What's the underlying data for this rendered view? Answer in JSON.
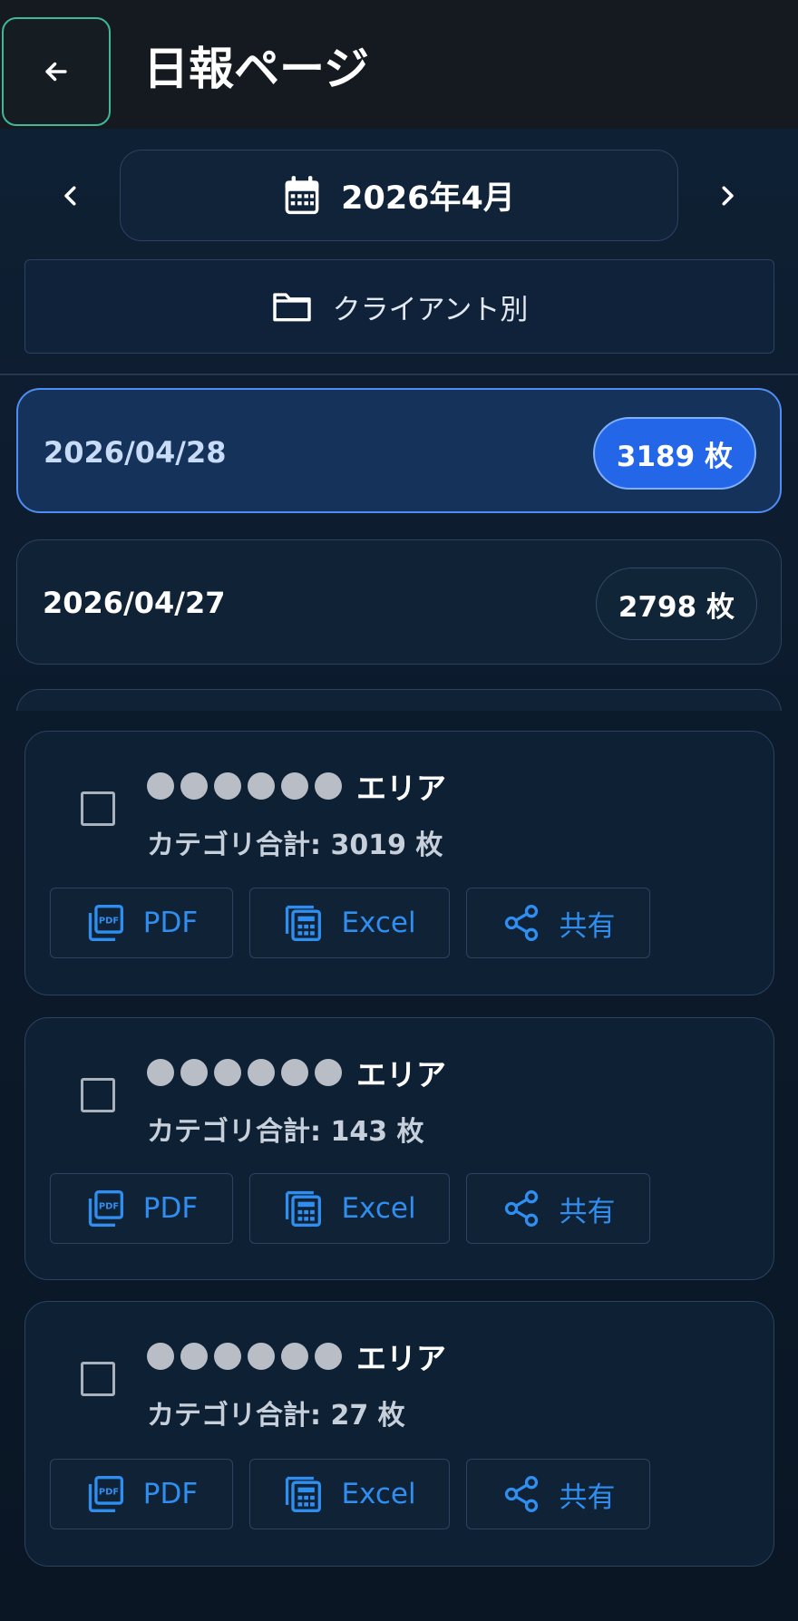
{
  "header": {
    "title": "日報ページ"
  },
  "month_nav": {
    "label": "2026年4月"
  },
  "filter": {
    "label": "クライアント別"
  },
  "dates": [
    {
      "date": "2026/04/28",
      "count": "3189 枚",
      "selected": true
    },
    {
      "date": "2026/04/27",
      "count": "2798 枚",
      "selected": false
    }
  ],
  "areas": [
    {
      "name": "エリア",
      "total": "カテゴリ合計: 3019 枚",
      "pdf": "PDF",
      "excel": "Excel",
      "share": "共有"
    },
    {
      "name": "エリア",
      "total": "カテゴリ合計: 143 枚",
      "pdf": "PDF",
      "excel": "Excel",
      "share": "共有"
    },
    {
      "name": "エリア",
      "total": "カテゴリ合計: 27 枚",
      "pdf": "PDF",
      "excel": "Excel",
      "share": "共有"
    }
  ],
  "colors": {
    "accent": "#2f8ef0",
    "selected_pill": "#2466e8",
    "back_border": "#3fb89a"
  },
  "icons": [
    "arrow-left-icon",
    "chevron-left-icon",
    "chevron-right-icon",
    "calendar-icon",
    "folder-icon",
    "pdf-icon",
    "calculator-icon",
    "share-icon"
  ]
}
